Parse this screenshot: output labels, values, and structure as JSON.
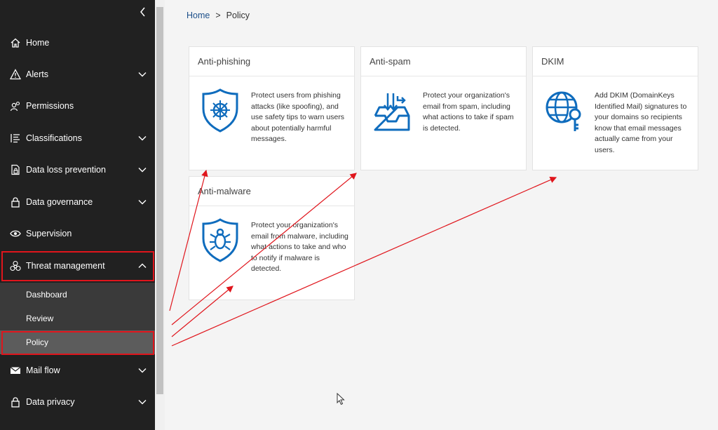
{
  "breadcrumb": {
    "home": "Home",
    "separator": ">",
    "current": "Policy"
  },
  "sidebar": {
    "items": [
      {
        "label": "Home",
        "icon": "home-icon"
      },
      {
        "label": "Alerts",
        "icon": "warning-icon"
      },
      {
        "label": "Permissions",
        "icon": "people-icon"
      },
      {
        "label": "Classifications",
        "icon": "list-icon"
      },
      {
        "label": "Data loss prevention",
        "icon": "dlp-icon"
      },
      {
        "label": "Data governance",
        "icon": "lock-icon"
      },
      {
        "label": "Supervision",
        "icon": "eye-icon"
      },
      {
        "label": "Threat management",
        "icon": "biohazard-icon"
      },
      {
        "label": "Mail flow",
        "icon": "mail-icon"
      },
      {
        "label": "Data privacy",
        "icon": "lock-icon"
      }
    ],
    "threat_submenu": [
      "Dashboard",
      "Review",
      "Policy"
    ]
  },
  "cards": [
    {
      "title": "Anti-phishing",
      "icon": "shield-phishing-icon",
      "description": "Protect users from phishing attacks (like spoofing), and use safety tips to warn users about potentially harmful messages."
    },
    {
      "title": "Anti-spam",
      "icon": "inbox-spam-icon",
      "description": "Protect your organization's email from spam, including what actions to take if spam is detected."
    },
    {
      "title": "DKIM",
      "icon": "globe-key-icon",
      "description": "Add DKIM (DomainKeys Identified Mail) signatures to your domains so recipients know that email messages actually came from your users."
    },
    {
      "title": "Anti-malware",
      "icon": "shield-bug-icon",
      "description": "Protect your organization's email from malware, including what actions to take and who to notify if malware is detected."
    }
  ],
  "colors": {
    "sidebar_bg": "#212121",
    "accent": "#0f6cbd",
    "highlight": "#e0151c"
  }
}
